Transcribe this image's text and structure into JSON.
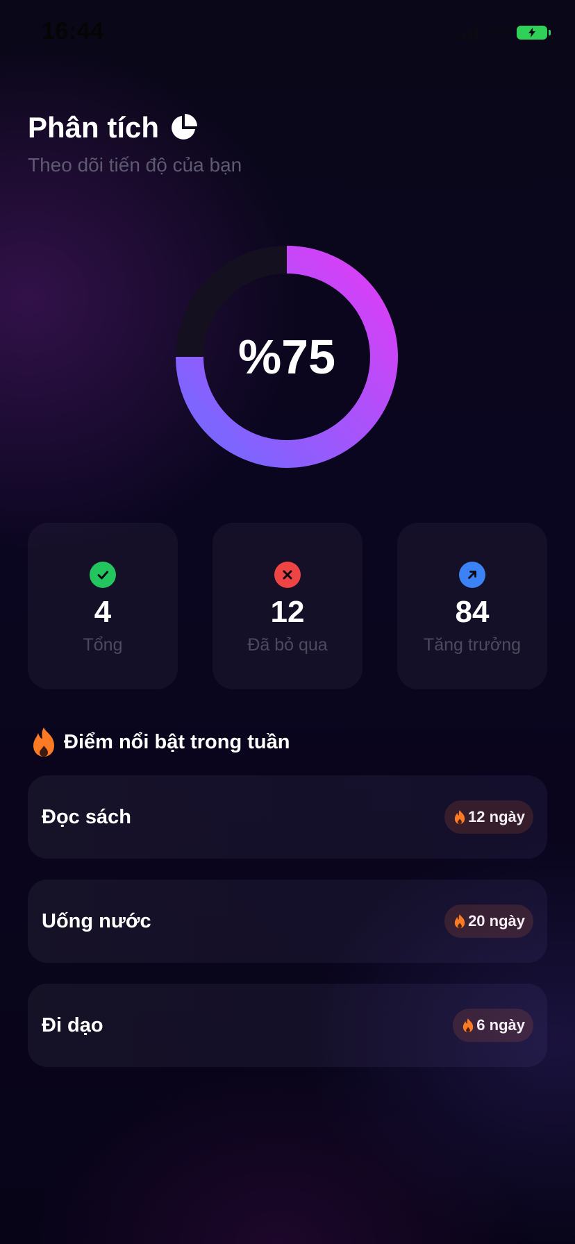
{
  "status_bar": {
    "time": "16:44"
  },
  "header": {
    "title": "Phân tích",
    "subtitle": "Theo dõi tiến độ của bạn",
    "title_icon": "pie-chart-icon"
  },
  "progress": {
    "label": "%75",
    "value": 0.75,
    "gradient_start": "#6f6bff",
    "gradient_end": "#e03cf6",
    "track_color": "#15101f"
  },
  "stats": [
    {
      "icon": "check-icon",
      "color": "#22c55e",
      "value": "4",
      "label": "Tổng"
    },
    {
      "icon": "x-icon",
      "color": "#ef4444",
      "value": "12",
      "label": "Đã bỏ qua"
    },
    {
      "icon": "arrow-up-right-icon",
      "color": "#3b82f6",
      "value": "84",
      "label": "Tăng trưởng"
    }
  ],
  "highlights": {
    "title": "Điểm nổi bật trong tuần",
    "icon": "flame-icon",
    "items": [
      {
        "name": "Đọc sách",
        "streak": "12 ngày"
      },
      {
        "name": "Uống nước",
        "streak": "20 ngày"
      },
      {
        "name": "Đi dạo",
        "streak": "6 ngày"
      }
    ]
  },
  "colors": {
    "flame": "#fb7a24",
    "battery": "#2fd158"
  }
}
